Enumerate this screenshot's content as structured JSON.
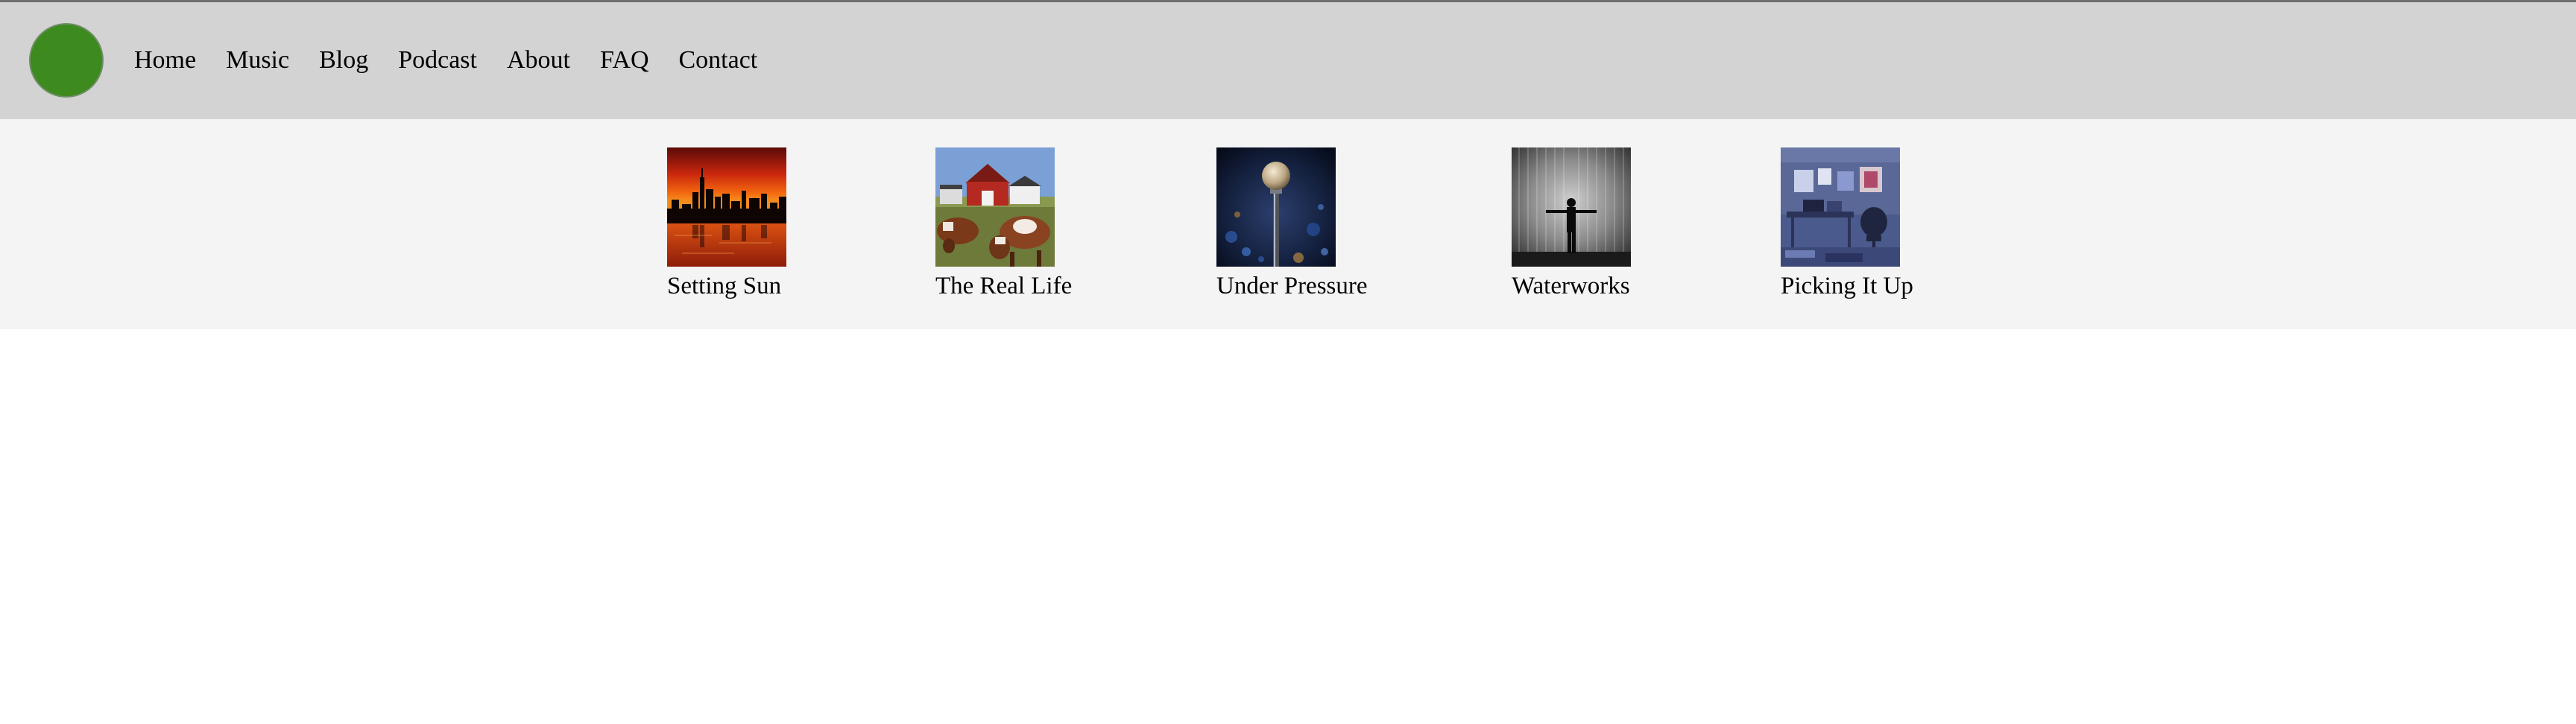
{
  "header": {
    "background": "#d3d3d3",
    "logo": {
      "color": "#3d8a1e"
    },
    "nav": [
      "Home",
      "Music",
      "Blog",
      "Podcast",
      "About",
      "FAQ",
      "Contact"
    ]
  },
  "gallery": {
    "items": [
      {
        "title": "Setting Sun",
        "image": "city-skyline-sunset"
      },
      {
        "title": "The Real Life",
        "image": "farm-cows-red-barn"
      },
      {
        "title": "Under Pressure",
        "image": "microphone-stage-bokeh"
      },
      {
        "title": "Waterworks",
        "image": "man-in-rain"
      },
      {
        "title": "Picking It Up",
        "image": "music-studio-room"
      }
    ]
  }
}
